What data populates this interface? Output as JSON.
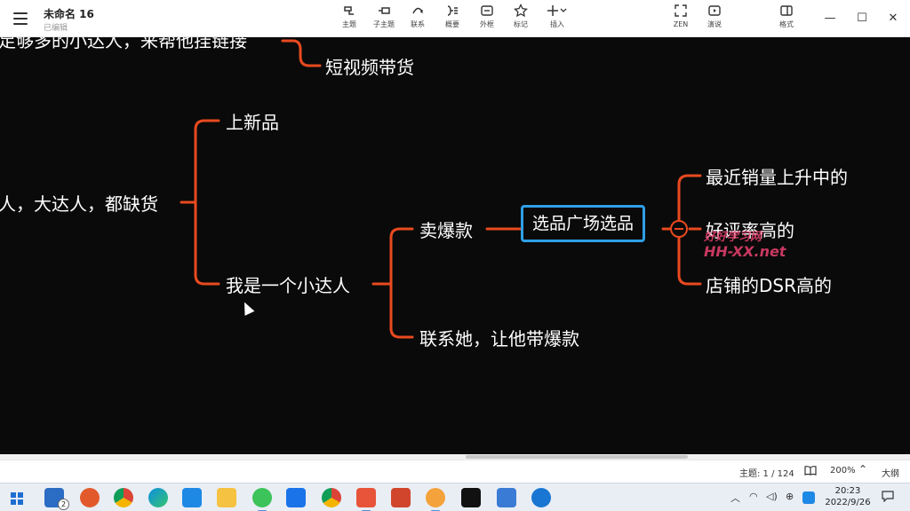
{
  "app": {
    "doc_title": "未命名 16",
    "doc_status": "已编辑"
  },
  "toolbar": {
    "topic": "主题",
    "subtopic": "子主题",
    "relation": "联系",
    "summary": "概要",
    "boundary": "外框",
    "marker": "标记",
    "insert": "插入",
    "zen": "ZEN",
    "pitch": "演说",
    "format": "格式"
  },
  "window": {
    "minimize": "—",
    "maximize": "☐",
    "close": "✕"
  },
  "mindmap": {
    "partial_top": "足够多的小达人，来帮他挂链接",
    "short_video": "短视频带货",
    "new_product": "上新品",
    "partial_left": "人，大达人，都缺货",
    "small_talent": "我是一个小达人",
    "bestseller": "卖爆款",
    "contact": "联系她，让他带爆款",
    "selection": "选品广场选品",
    "child1": "最近销量上升中的",
    "child2": "好评率高的",
    "child3": "店铺的DSR高的",
    "line_color": "#e84a1f",
    "selected_color": "#2f9fe6"
  },
  "watermark": {
    "line1": "好好学习网",
    "line2": "HH-XX.net"
  },
  "status": {
    "topic_count": "主题: 1 / 124",
    "zoom": "200%",
    "outline": "大纲"
  },
  "clock": {
    "time": "20:23",
    "date": "2022/9/26"
  },
  "taskbar": {
    "mail_badge": "2"
  }
}
